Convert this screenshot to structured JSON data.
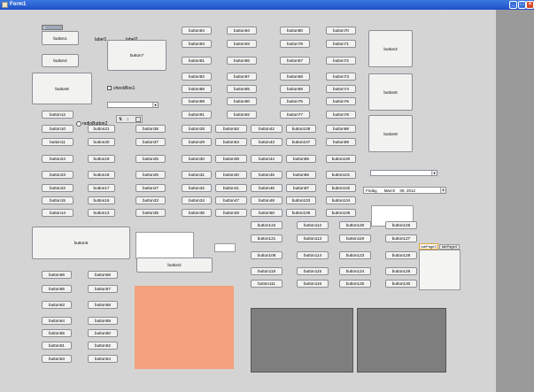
{
  "window": {
    "title": "Form1",
    "minimize_glyph": "_",
    "maximize_glyph": "□",
    "close_glyph": "×"
  },
  "labels": {
    "label1": "label1",
    "label2": "label2"
  },
  "checkbox1": "checkBox1",
  "radiobutton2": "radioButton2",
  "spinner": {
    "value": "0"
  },
  "date": {
    "day": "Friday",
    "month": "March",
    "date": "09, 2012"
  },
  "tabs": [
    "tabPage3",
    "tabPage4"
  ],
  "buttons": {
    "b1": "button1",
    "b2": "button2",
    "b3": "button3",
    "b4": "button4",
    "b5": "button5",
    "b6": "button6",
    "b7": "button7",
    "b8": "button8",
    "b9": "button9",
    "b10": "button10",
    "b11": "button11",
    "b12": "button12",
    "b13": "button13",
    "b14": "button14",
    "b15": "button15",
    "b16": "button16",
    "b17": "button17",
    "b18": "button18",
    "b19": "button19",
    "b20": "button20",
    "b21": "button21",
    "b22": "button22",
    "b23": "button23",
    "b24": "button24",
    "b25": "button25",
    "b26": "button26",
    "b27": "button27",
    "b28": "button28",
    "b29": "button29",
    "b30": "button30",
    "b31": "button31",
    "b32": "button32",
    "b33": "button33",
    "b34": "button34",
    "b35": "button35",
    "b36": "button36",
    "b37": "button37",
    "b38": "button38",
    "b39": "button39",
    "b40": "button40",
    "b41": "button41",
    "b42": "button42",
    "b43": "button43",
    "b44": "button44",
    "b45": "button45",
    "b46": "button46",
    "b47": "button47",
    "b48": "button48",
    "b49": "button49",
    "b50": "button50",
    "b51": "button51",
    "b52": "button52",
    "b53": "button53",
    "b54": "button54",
    "b55": "button55",
    "b56": "button56",
    "b57": "button57",
    "b58": "button58",
    "b59": "button59",
    "b60": "button60",
    "b61": "button61",
    "b62": "button62",
    "b63": "button63",
    "b64": "button64",
    "b65": "button65",
    "b66": "button66",
    "b67": "button67",
    "b68": "button68",
    "b69": "button69",
    "b70": "button70",
    "b71": "button71",
    "b72": "button72",
    "b73": "button73",
    "b74": "button74",
    "b75": "button75",
    "b76": "button76",
    "b77": "button77",
    "b78": "button78",
    "b79": "button79",
    "b80": "button80",
    "b81": "button81",
    "b82": "button82",
    "b83": "button83",
    "b84": "button84",
    "b85": "button85",
    "b86": "button86",
    "b87": "button87",
    "b88": "button88",
    "b89": "button89",
    "b90": "button90",
    "b91": "button91",
    "b92": "button92",
    "b93": "button93",
    "b94": "button94",
    "b95": "button95",
    "b96": "button96",
    "b97": "button97",
    "b98": "button98",
    "b99": "button99",
    "b100": "button100",
    "b101": "button101",
    "b102": "button102",
    "b103": "button103",
    "b104": "button104",
    "b105": "button105",
    "b106": "button106",
    "b107": "button107",
    "b108": "button108",
    "b109": "button109",
    "b110": "button110",
    "b111": "button111",
    "b112": "button112",
    "b113": "button113",
    "b114": "button114",
    "b115": "button115",
    "b116": "button116",
    "b117": "button117",
    "b118": "button118",
    "b119": "button119",
    "b120": "button120",
    "b121": "button121",
    "b122": "button122",
    "b123": "button123",
    "b124": "button124",
    "b125": "button125",
    "b126": "button126",
    "b127": "button127",
    "b128": "button128",
    "b129": "button129",
    "b130": "button130"
  },
  "colors": {
    "salmon_panel": "#f4a07c",
    "gray_panel": "#7e7e7e",
    "titlebar": "#2458d0"
  }
}
